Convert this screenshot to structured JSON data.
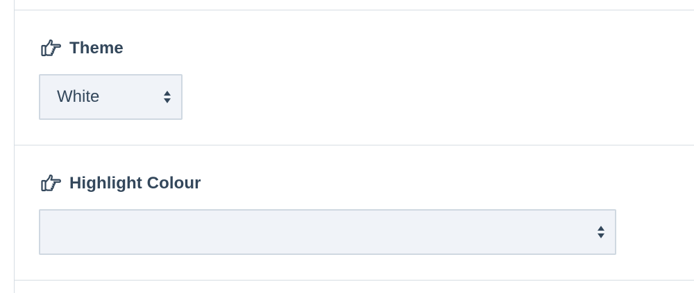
{
  "settings": {
    "theme": {
      "label": "Theme",
      "selected": "White",
      "icon": "pointing-hand-icon"
    },
    "highlight": {
      "label": "Highlight Colour",
      "selected": "",
      "icon": "pointing-hand-icon"
    }
  },
  "colors": {
    "text": "#33475b",
    "select_bg": "#f0f3f8",
    "select_border": "#cfd8e1",
    "divider": "#d6dde3"
  }
}
